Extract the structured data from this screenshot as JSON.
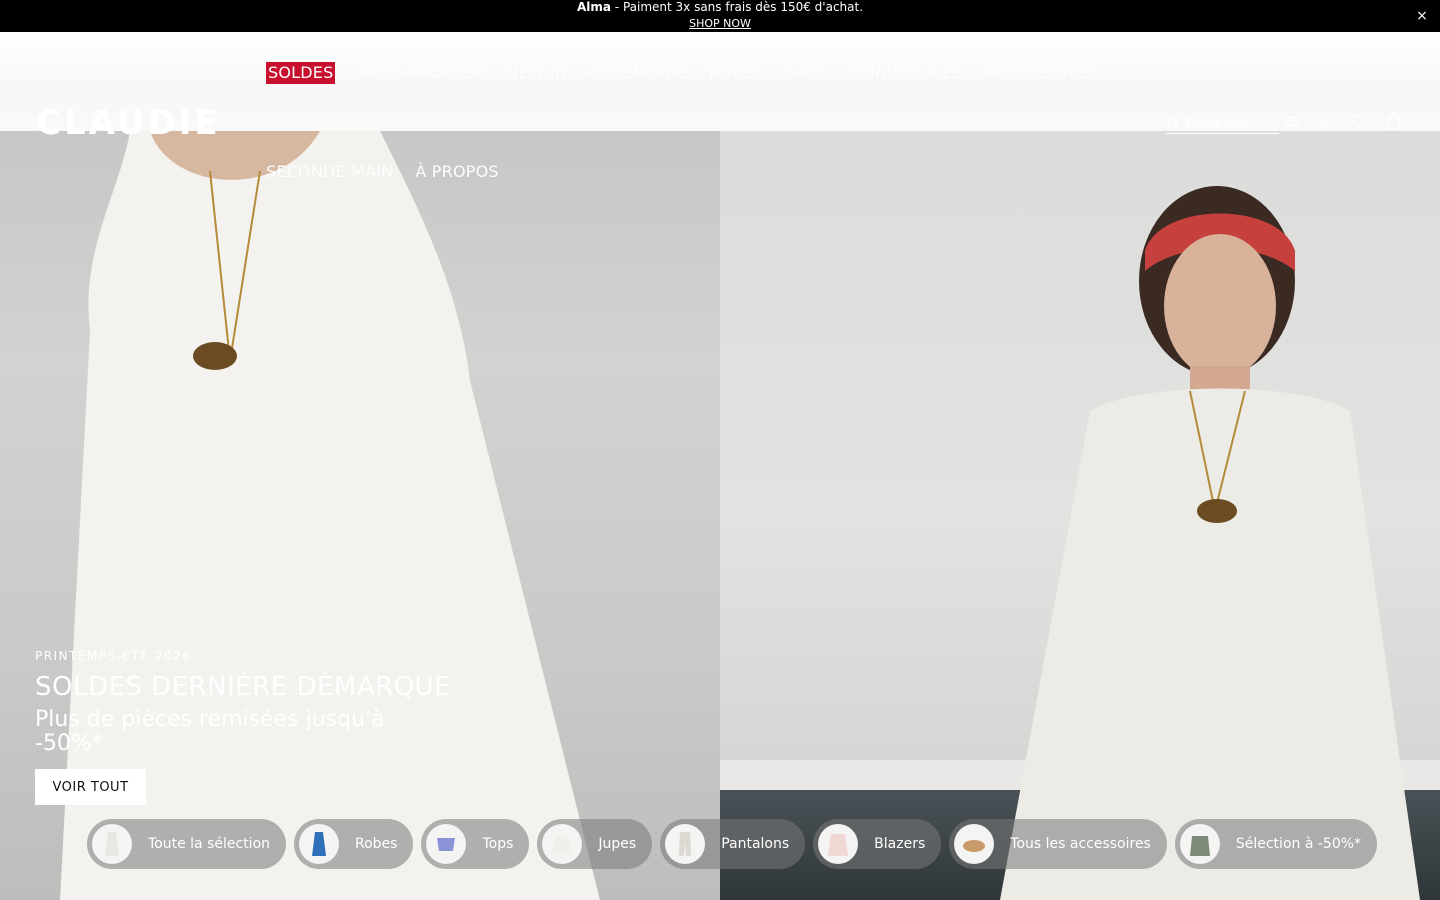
{
  "announcement": {
    "brand": "Alma",
    "text": " - Paiment 3x sans frais dès 150€ d'achat.",
    "link": "SHOP NOW",
    "close": "×"
  },
  "header": {
    "logo": "CLAUDIE",
    "nav": [
      "SOLDES",
      "PRÊT-À-PORTER",
      "NEW IN",
      "CÉRÉMONIE",
      "ROBES",
      "SACS",
      "CHAUSSURES",
      "ACCESSOIRES"
    ],
    "nav2": [
      "SECONDE MAIN",
      "À PROPOS"
    ],
    "search_placeholder": "Rechercher",
    "sale_color": "#c8102e"
  },
  "hero": {
    "eyebrow": "PRINTEMPS-ÉTÉ 2026",
    "headline": "SOLDES DERNIÈRE DÉMARQUE",
    "subline": "Plus de pièces remisées jusqu'à -50%*",
    "cta": "VOIR TOUT"
  },
  "categories": [
    {
      "label": "Toute la sélection",
      "thumb_color": "#f1f0ec"
    },
    {
      "label": "Robes",
      "thumb_color": "#2f6fb7"
    },
    {
      "label": "Tops",
      "thumb_color": "#8a93d6"
    },
    {
      "label": "Jupes",
      "thumb_color": "#f4f4f2"
    },
    {
      "label": "Pantalons",
      "thumb_color": "#e9e6e0"
    },
    {
      "label": "Blazers",
      "thumb_color": "#f1d7d3"
    },
    {
      "label": "Tous les accessoires",
      "thumb_color": "#c99a6a"
    },
    {
      "label": "Sélection à -50%*",
      "thumb_color": "#7d8a7a"
    }
  ]
}
